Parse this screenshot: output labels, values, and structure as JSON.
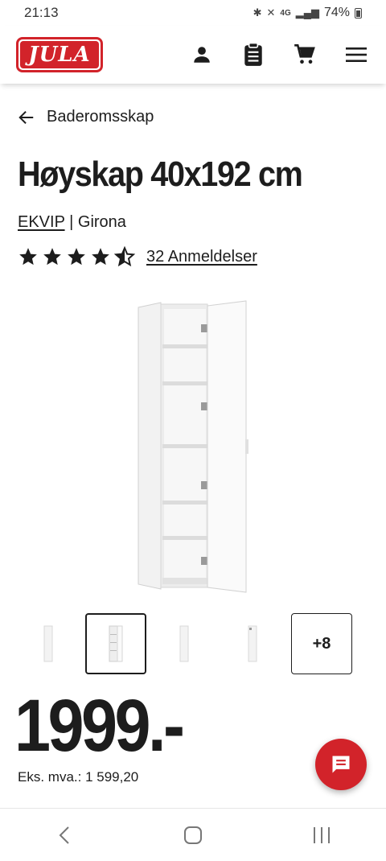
{
  "status_bar": {
    "time": "21:13",
    "network": "4G",
    "battery": "74%",
    "icons": [
      "bluetooth-icon",
      "mute-icon",
      "signal-icon",
      "battery-icon"
    ]
  },
  "header": {
    "logo_text": "JULA",
    "icons": [
      "account-icon",
      "shopping-list-icon",
      "cart-icon",
      "menu-icon"
    ]
  },
  "breadcrumb": {
    "label": "Baderomsskap"
  },
  "product": {
    "title": "Høyskap 40x192 cm",
    "brand": "EKVIP",
    "separator": "|",
    "series": "Girona",
    "rating": 4.5,
    "reviews_label": "32 Anmeldelser",
    "price": "1999.-",
    "ex_vat": "Eks. mva.: 1 599,20"
  },
  "gallery": {
    "more_label": "+8",
    "selected_index": 1
  },
  "colors": {
    "brand_red": "#d2232a",
    "text": "#1d1d1d"
  }
}
